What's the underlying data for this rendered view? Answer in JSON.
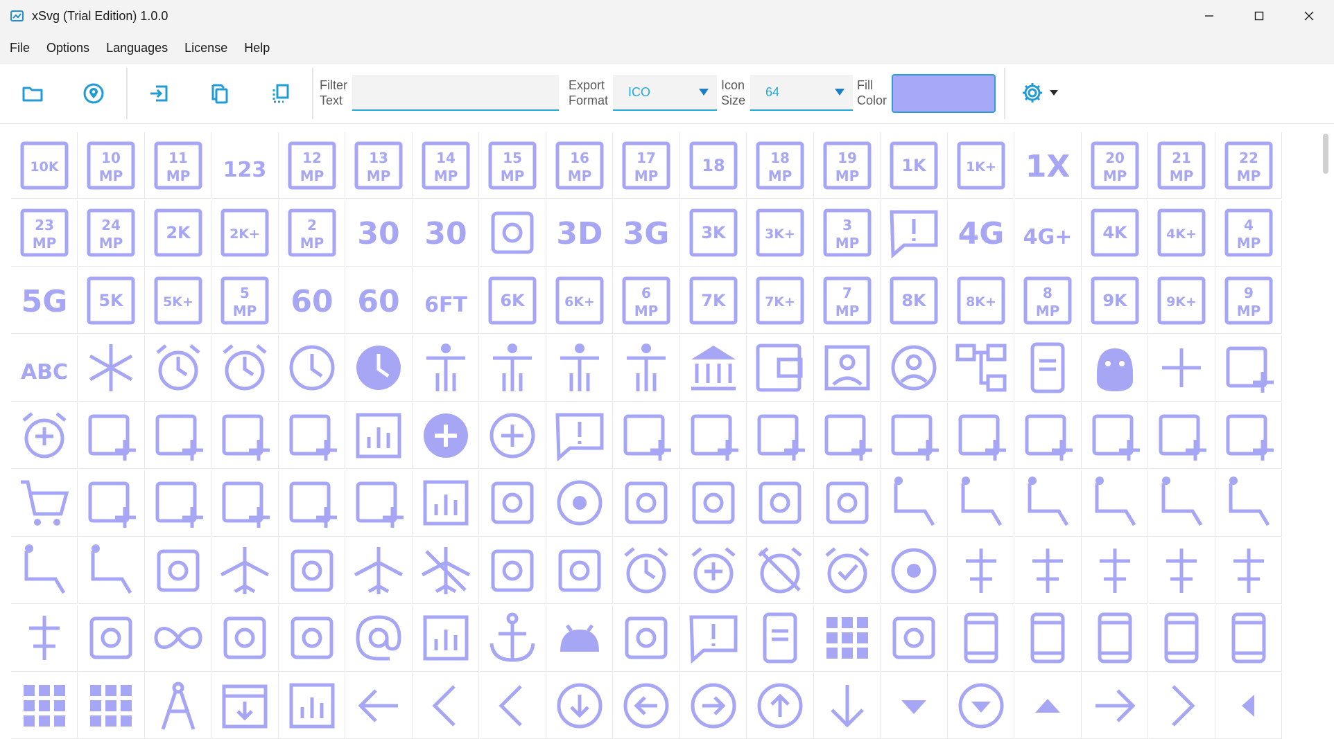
{
  "window": {
    "title": "xSvg (Trial Edition)  1.0.0",
    "controls": [
      "minimize",
      "maximize",
      "close"
    ]
  },
  "menu": [
    {
      "label": "File",
      "name": "menu-file"
    },
    {
      "label": "Options",
      "name": "menu-options"
    },
    {
      "label": "Languages",
      "name": "menu-languages"
    },
    {
      "label": "License",
      "name": "menu-license"
    },
    {
      "label": "Help",
      "name": "menu-help"
    }
  ],
  "toolbar": {
    "buttons": [
      "folder-icon",
      "location-pin-icon",
      "export-icon",
      "copy-icon",
      "select-copy-icon"
    ],
    "filter_label_1": "Filter",
    "filter_label_2": "Text",
    "filter_value": "",
    "export_label_1": "Export",
    "export_label_2": "Format",
    "export_value": "ICO",
    "size_label_1": "Icon",
    "size_label_2": "Size",
    "size_value": "64",
    "fill_label_1": "Fill",
    "fill_label_2": "Color",
    "fill_color": "#a8a8f8",
    "settings_icon": "gear-icon"
  },
  "colors": {
    "icon": "#a6a6f4",
    "accent": "#24a9d6",
    "toolbar_icon": "#1f9bd6"
  },
  "icons": [
    [
      "10k",
      "10mp",
      "11mp",
      "123",
      "12mp",
      "13mp",
      "14mp",
      "15mp",
      "16mp",
      "17mp",
      "18",
      "18mp",
      "19mp",
      "1k",
      "1k-plus",
      "1x",
      "20mp",
      "21mp",
      "22mp"
    ],
    [
      "23mp",
      "24mp",
      "2k",
      "2k-plus",
      "2mp",
      "30fps",
      "30fps-select",
      "360",
      "3d-rotation",
      "3g",
      "3k",
      "3k-plus",
      "3mp",
      "3p",
      "4g",
      "4g-plus",
      "4k",
      "4k-plus",
      "4mp"
    ],
    [
      "5g",
      "5k",
      "5k-plus",
      "5mp",
      "60fps",
      "60fps-select",
      "6-ft-apart",
      "6k",
      "6k-plus",
      "6mp",
      "7k",
      "7k-plus",
      "7mp",
      "8k",
      "8k-plus",
      "8mp",
      "9k",
      "9k-plus",
      "9mp"
    ],
    [
      "abc",
      "ac-unit",
      "access-alarm",
      "access-alarms",
      "access-time",
      "access-time-filled",
      "accessibility",
      "accessibility-new",
      "accessible",
      "accessible-forward",
      "account-balance",
      "account-balance-wallet",
      "account-box",
      "account-circle",
      "account-tree",
      "ad-units",
      "adb",
      "add",
      "add-a-photo"
    ],
    [
      "add-alarm",
      "add-alert",
      "add-box",
      "add-business",
      "add-card",
      "add-chart",
      "add-circle",
      "add-circle-outline",
      "add-comment",
      "add-home",
      "add-home-work",
      "add-ic-call",
      "add-link",
      "add-location",
      "add-location-alt",
      "add-moderator",
      "add-photo-alternate",
      "add-reaction",
      "add-road"
    ],
    [
      "add-shopping-cart",
      "add-task",
      "add-to-drive",
      "add-to-home-screen",
      "add-to-photos",
      "add-to-queue",
      "addchart",
      "adf-scanner",
      "adjust",
      "admin-panel-settings",
      "ads-click",
      "agriculture",
      "air",
      "airline-seat-flat",
      "airline-seat-flat-angled",
      "airline-seat-individual-suite",
      "airline-seat-legroom-extra",
      "airline-seat-legroom-normal",
      "airline-seat-legroom-reduced"
    ],
    [
      "airline-seat-recline-extra",
      "airline-seat-recline-normal",
      "airline-stops",
      "airlines",
      "airplane-ticket",
      "airplanemode-active",
      "airplanemode-inactive",
      "airplay",
      "airport-shuttle",
      "alarm",
      "alarm-add",
      "alarm-off",
      "alarm-on",
      "album",
      "align-horizontal-center",
      "align-horizontal-left",
      "align-horizontal-right",
      "align-vertical-bottom",
      "align-vertical-center"
    ],
    [
      "align-vertical-top",
      "all-inbox",
      "all-inclusive",
      "all-out",
      "alt-route",
      "alternate-email",
      "analytics",
      "anchor",
      "android",
      "animation",
      "announcement",
      "aod",
      "apartment",
      "api",
      "app-blocking",
      "app-registration",
      "app-settings-alt",
      "app-shortcut",
      "approval"
    ],
    [
      "apps",
      "apps-outage",
      "architecture",
      "archive",
      "area-chart",
      "arrow-back",
      "arrow-back-ios",
      "arrow-back-ios-new",
      "arrow-circle-down",
      "arrow-circle-left",
      "arrow-circle-right",
      "arrow-circle-up",
      "arrow-downward",
      "arrow-drop-down",
      "arrow-drop-down-circle",
      "arrow-drop-up",
      "arrow-forward",
      "arrow-forward-ios",
      "arrow-left"
    ]
  ],
  "icon_text": {
    "10k": "10K",
    "123": "123",
    "18": "18",
    "1k": "1K",
    "1k-plus": "1K+",
    "1x": "1X",
    "2k": "2K",
    "2k-plus": "2K+",
    "30fps": "30",
    "3g": "3G",
    "3k": "3K",
    "3k-plus": "3K+",
    "4g": "4G",
    "4g-plus": "4G+",
    "4k": "4K",
    "4k-plus": "4K+",
    "5g": "5G",
    "5k": "5K",
    "5k-plus": "5K+",
    "60fps": "60",
    "6k": "6K",
    "6k-plus": "6K+",
    "7k": "7K",
    "7k-plus": "7K+",
    "8k": "8K",
    "8k-plus": "8K+",
    "9k": "9K",
    "9k-plus": "9K+",
    "abc": "ABC",
    "3d-rotation": "3D",
    "30fps-select": "30",
    "60fps-select": "60",
    "6-ft-apart": "6FT"
  }
}
